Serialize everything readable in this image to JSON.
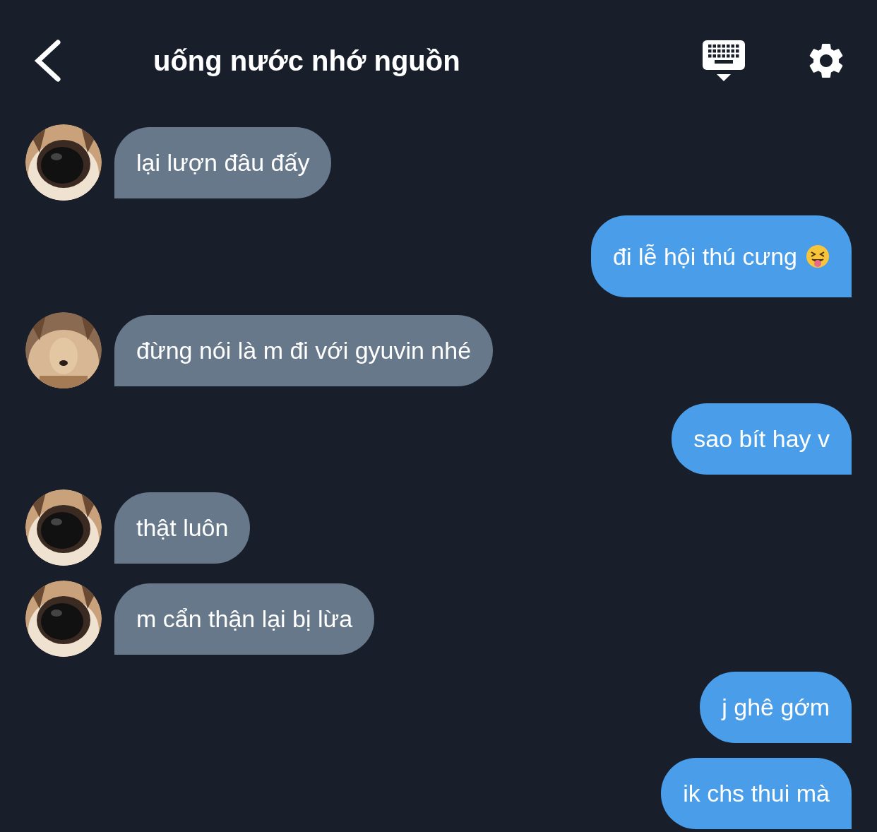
{
  "header": {
    "title": "uống nước nhớ nguồn"
  },
  "messages": [
    {
      "kind": "incoming",
      "text": "lại lượn đâu đấy"
    },
    {
      "kind": "outgoing",
      "text": "đi lễ hội thú cưng",
      "emoji": true
    },
    {
      "kind": "incoming",
      "text": "đừng nói là m đi với gyuvin nhé"
    },
    {
      "kind": "outgoing",
      "text": "sao bít hay v"
    },
    {
      "kind": "incoming",
      "text": "thật luôn"
    },
    {
      "kind": "incoming",
      "text": "m cẩn thận lại bị lừa"
    },
    {
      "kind": "outgoing",
      "text": "j ghê gớm"
    },
    {
      "kind": "outgoing",
      "text": "ik chs thui mà"
    }
  ]
}
